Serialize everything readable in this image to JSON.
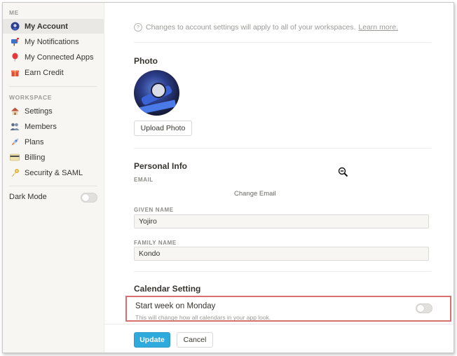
{
  "sidebar": {
    "section_me": "ME",
    "section_workspace": "WORKSPACE",
    "me_items": [
      {
        "label": "My Account",
        "icon": "user-avatar-icon",
        "active": true
      },
      {
        "label": "My Notifications",
        "icon": "mailbox-icon"
      },
      {
        "label": "My Connected Apps",
        "icon": "balloon-icon"
      },
      {
        "label": "Earn Credit",
        "icon": "gift-icon"
      }
    ],
    "workspace_items": [
      {
        "label": "Settings",
        "icon": "house-icon"
      },
      {
        "label": "Members",
        "icon": "people-icon"
      },
      {
        "label": "Plans",
        "icon": "rocket-icon"
      },
      {
        "label": "Billing",
        "icon": "credit-card-icon"
      },
      {
        "label": "Security & SAML",
        "icon": "key-icon"
      }
    ],
    "dark_mode_label": "Dark Mode",
    "dark_mode_on": false
  },
  "main": {
    "info_text": "Changes to account settings will apply to all of your workspaces.",
    "info_link": "Learn more.",
    "photo_heading": "Photo",
    "upload_button": "Upload Photo",
    "personal_heading": "Personal Info",
    "email_label": "EMAIL",
    "change_email": "Change Email",
    "given_name_label": "GIVEN NAME",
    "given_name_value": "Yojiro",
    "family_name_label": "FAMILY NAME",
    "family_name_value": "Kondo",
    "calendar_heading": "Calendar Setting",
    "start_week_title": "Start week on Monday",
    "start_week_desc": "This will change how all calendars in your app look.",
    "start_week_on": false,
    "update_button": "Update",
    "cancel_button": "Cancel"
  },
  "colors": {
    "accent": "#2eaadc",
    "highlight_border": "#d8706f",
    "sidebar_bg": "#f7f6f3"
  }
}
